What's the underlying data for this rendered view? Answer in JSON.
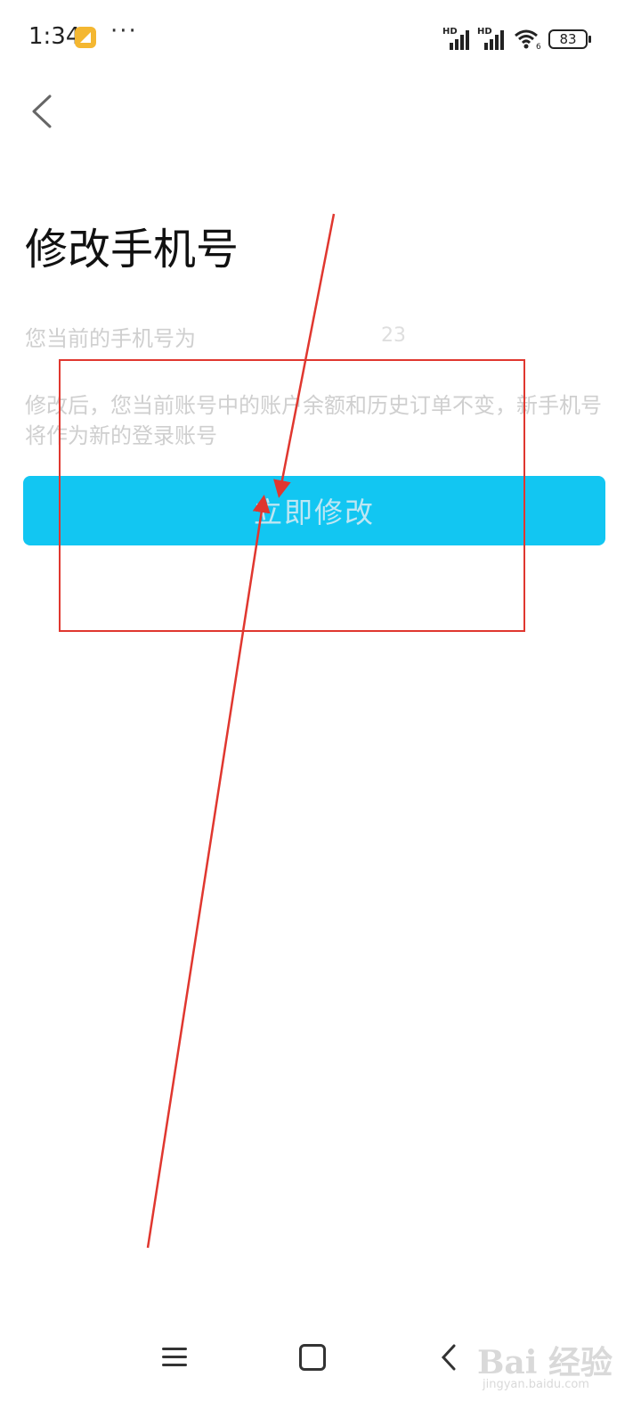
{
  "status_bar": {
    "time": "1:34",
    "more": "···",
    "signal_label_1": "HD",
    "signal_label_2": "HD",
    "wifi_suffix": "6",
    "battery": "83"
  },
  "header": {
    "back_icon": "chevron-left-icon"
  },
  "page": {
    "title": "修改手机号",
    "current_phone_label": "您当前的手机号为",
    "current_phone_tail": "23",
    "description": "修改后，您当前账号中的账户余额和历史订单不变，新手机号将作为新的登录账号",
    "change_button": "立即修改"
  },
  "annotation": {
    "color": "#e0372f"
  },
  "colors": {
    "button": "#12c6f2",
    "button_text": "#bde6f3",
    "muted_text": "#cfcfcf"
  },
  "nav_bar": {
    "menu_icon": "menu-icon",
    "home_icon": "home-icon",
    "back_icon": "back-icon"
  },
  "watermark": {
    "logo": "Bai 经验",
    "site": "jingyan.baidu.com"
  }
}
